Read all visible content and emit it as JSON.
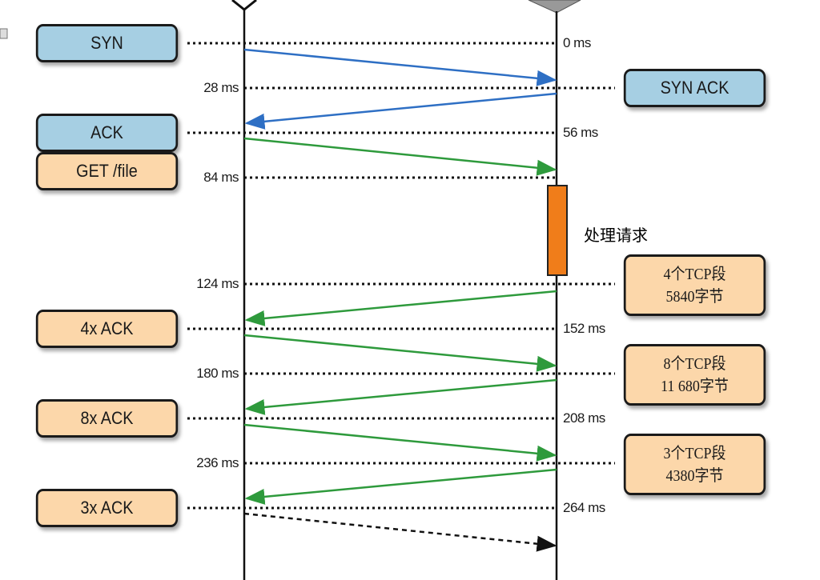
{
  "client_messages": [
    {
      "label": "SYN"
    },
    {
      "label": "ACK"
    },
    {
      "label": "GET /file"
    },
    {
      "label": "4x ACK"
    },
    {
      "label": "8x ACK"
    },
    {
      "label": "3x ACK"
    }
  ],
  "server_messages": [
    {
      "label": "SYN ACK"
    },
    {
      "line1": "4个TCP段",
      "line2": "5840字节"
    },
    {
      "line1": "8个TCP段",
      "line2": "11 680字节"
    },
    {
      "line1": "3个TCP段",
      "line2": "4380字节"
    }
  ],
  "times": [
    "0 ms",
    "28 ms",
    "56 ms",
    "84 ms",
    "124 ms",
    "152 ms",
    "180 ms",
    "208 ms",
    "236 ms",
    "264 ms"
  ],
  "processing_label": "处理请求",
  "colors": {
    "handshake_arrow": "#2e6fc4",
    "data_arrow": "#2e9a3c",
    "processing": "#f07d1a",
    "client_box": "#a6cfe3",
    "data_box": "#fcd7aa"
  }
}
